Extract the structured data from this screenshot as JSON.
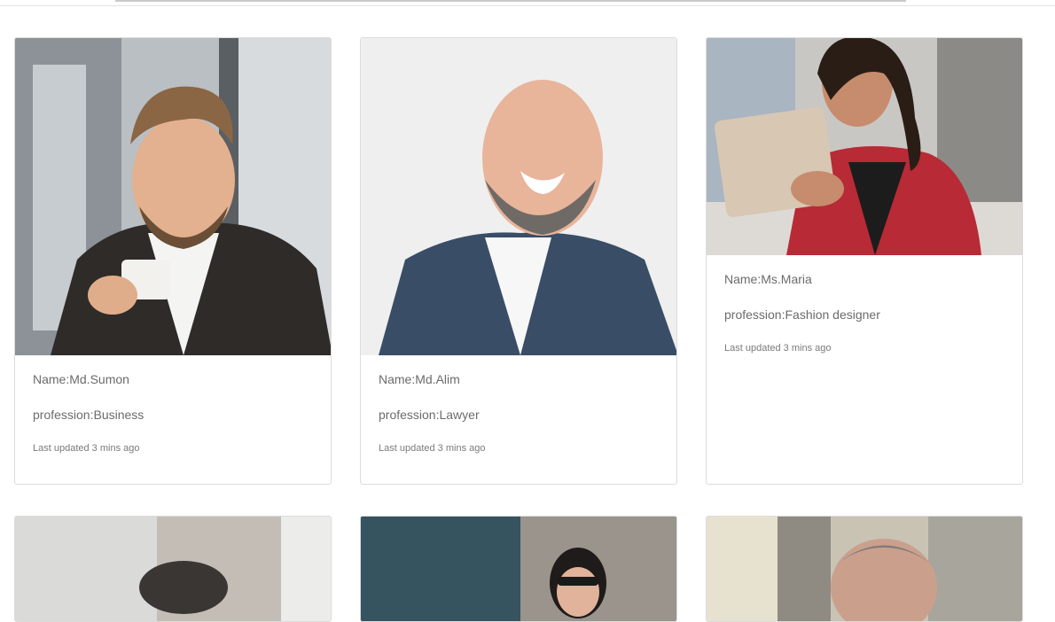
{
  "cards": [
    {
      "name": "Name:Md.Sumon",
      "profession": "profession:Business",
      "updated": "Last updated 3 mins ago"
    },
    {
      "name": "Name:Md.Alim",
      "profession": "profession:Lawyer",
      "updated": "Last updated 3 mins ago"
    },
    {
      "name": "Name:Ms.Maria",
      "profession": "profession:Fashion designer",
      "updated": "Last updated 3 mins ago"
    }
  ]
}
